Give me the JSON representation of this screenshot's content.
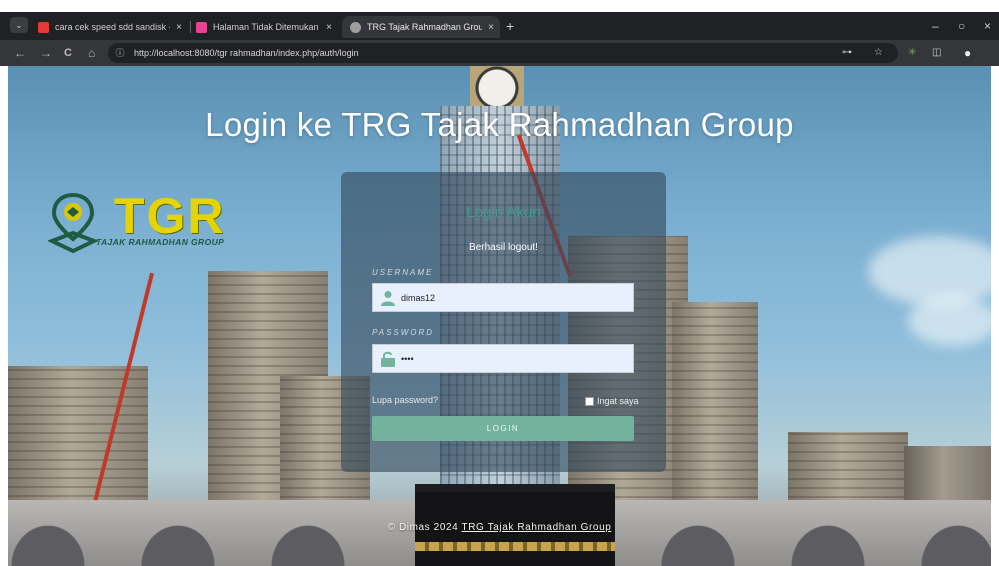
{
  "browser": {
    "tabs": [
      {
        "title": "cara cek speed sdd sandisk - Yo",
        "favicon_color": "#e53935",
        "close": "×"
      },
      {
        "title": "Halaman Tidak Ditemukan - In",
        "favicon_color": "#e84393",
        "close": "×"
      },
      {
        "title": "TRG Tajak Rahmadhan Group",
        "favicon_color": "#9e9e9e",
        "close": "×",
        "active": true
      }
    ],
    "new_tab": "+",
    "window_controls": {
      "minimize": "–",
      "maximize": "○",
      "close": "×"
    },
    "nav": {
      "back": "←",
      "forward": "→",
      "reload": "C",
      "home": "⌂"
    },
    "url": "http://localhost:8080/tgr rahmadhan/index.php/auth/login",
    "omnibox_icons": {
      "info": "ⓘ",
      "key": "⊶",
      "star": "☆",
      "ext": "✳",
      "puzzle": "◫",
      "profile": "●"
    }
  },
  "page": {
    "title": "Login ke TRG Tajak Rahmadhan Group",
    "logo": {
      "text": "TGR",
      "subtitle": "TAJAK RAHMADHAN GROUP",
      "color": "#e5d400"
    },
    "login": {
      "heading": "Login Akun",
      "message": "Berhasil logout!",
      "username_label": "USERNAME",
      "username_value": "dimas12",
      "password_label": "PASSWORD",
      "password_value": "••••",
      "forgot": "Lupa password?",
      "remember": "Ingat saya",
      "button": "LOGIN",
      "button_color": "#73b39e"
    },
    "footer": {
      "prefix": "© Dimas 2024",
      "brand": "TRG Tajak Rahmadhan Group"
    }
  }
}
